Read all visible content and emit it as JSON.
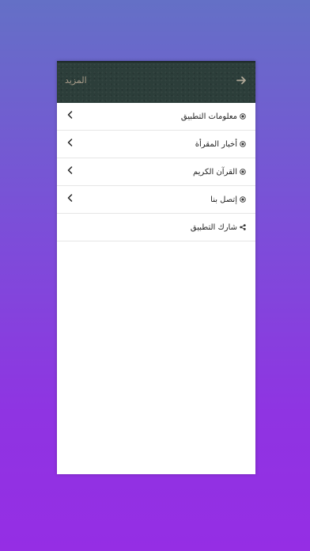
{
  "header": {
    "title": "المزيد",
    "back_icon": "arrow-right-icon",
    "background": "#2c3e3a",
    "title_color": "#a89c8a"
  },
  "menu": {
    "items": [
      {
        "label": "معلومات التطبيق",
        "icon": "radio-dot-icon",
        "has_chevron": true
      },
      {
        "label": "أخبار المقرأة",
        "icon": "radio-dot-icon",
        "has_chevron": true
      },
      {
        "label": "القرآن الكريم",
        "icon": "radio-dot-icon",
        "has_chevron": true
      },
      {
        "label": "إتصل بنا",
        "icon": "radio-dot-icon",
        "has_chevron": true
      },
      {
        "label": "شارك التطبيق",
        "icon": "share-icon",
        "has_chevron": false
      }
    ]
  },
  "colors": {
    "gradient_top": "#6470c6",
    "gradient_bottom": "#952ee4",
    "divider": "#e6e6e6"
  }
}
